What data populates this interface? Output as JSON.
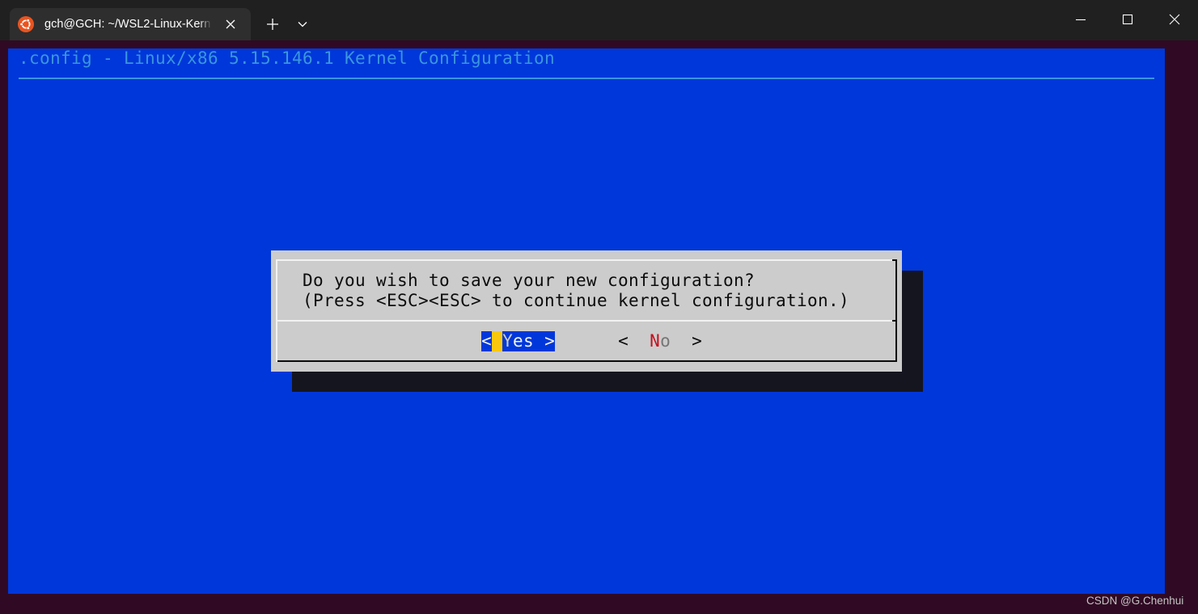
{
  "window": {
    "tab_title": "gch@GCH: ~/WSL2-Linux-Kern",
    "icons": {
      "tab_icon": "ubuntu-icon",
      "tab_close": "close-icon",
      "new_tab": "plus-icon",
      "dropdown": "chevron-down-icon",
      "minimize": "minimize-icon",
      "maximize": "maximize-icon",
      "close": "close-icon"
    }
  },
  "terminal": {
    "title": ".config - Linux/x86 5.15.146.1 Kernel Configuration"
  },
  "dialog": {
    "lines": [
      "Do you wish to save your new configuration?",
      "(Press <ESC><ESC> to continue kernel configuration.)"
    ],
    "buttons": [
      {
        "open": "<",
        "hotkey": "Y",
        "rest": "es",
        "close": ">",
        "selected": true
      },
      {
        "open": "<",
        "hotkey": "N",
        "rest": "o",
        "close": ">",
        "selected": false
      }
    ]
  },
  "watermark": "CSDN @G.Chenhui",
  "colors": {
    "title_bar": "#202020",
    "active_tab": "#2e2e2e",
    "terminal_frame": "#300A24",
    "terminal_bg": "#0037DA",
    "title_text": "#3A96DD",
    "dialog_bg": "#CCCCCC",
    "dialog_shadow": "#15151F",
    "dialog_text": "#0C0C0C",
    "border_light": "#F2F2F2",
    "border_dark": "#0C0C0C",
    "hotkey_inactive": "#C50F1F",
    "cursor": "#F9C80E",
    "ubuntu_orange": "#E95420"
  }
}
